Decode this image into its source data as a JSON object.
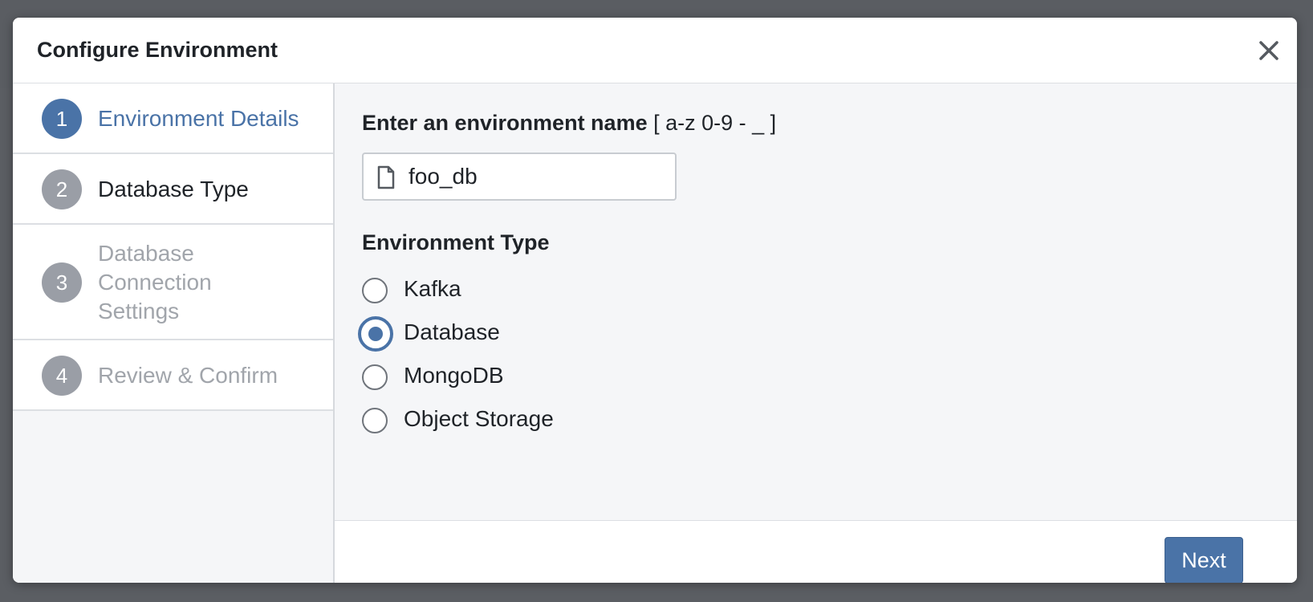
{
  "modal": {
    "title": "Configure Environment"
  },
  "steps": [
    {
      "number": "1",
      "label": "Environment Details",
      "state": "active"
    },
    {
      "number": "2",
      "label": "Database Type",
      "state": "enabled"
    },
    {
      "number": "3",
      "label": "Database Connection Settings",
      "state": "disabled"
    },
    {
      "number": "4",
      "label": "Review & Confirm",
      "state": "disabled"
    }
  ],
  "form": {
    "name_label": "Enter an environment name",
    "name_hint": "[ a-z 0-9 - _ ]",
    "name_value": "foo_db",
    "type_title": "Environment Type",
    "options": [
      {
        "label": "Kafka",
        "checked": false
      },
      {
        "label": "Database",
        "checked": true
      },
      {
        "label": "MongoDB",
        "checked": false
      },
      {
        "label": "Object Storage",
        "checked": false
      }
    ]
  },
  "footer": {
    "next_label": "Next"
  },
  "icons": {
    "close": "close-icon",
    "file": "file-icon"
  },
  "colors": {
    "accent": "#4a73a7",
    "step_inactive": "#9a9ea6",
    "text_disabled": "#a1a5ab"
  }
}
